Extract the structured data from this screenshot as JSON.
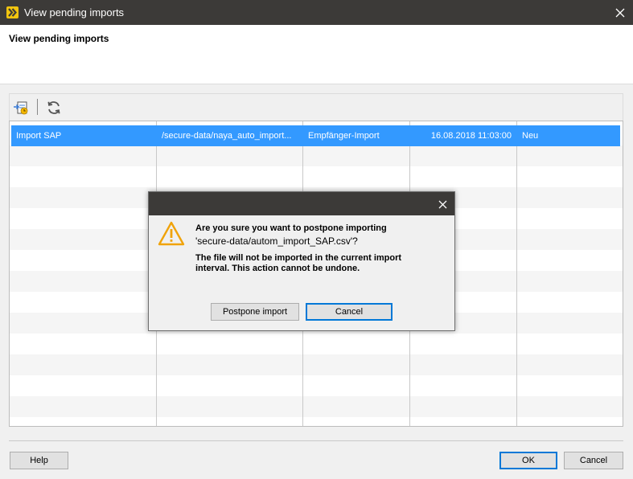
{
  "window": {
    "title": "View pending imports",
    "icon": "app-logo-icon",
    "close_icon": "close-icon"
  },
  "header": {
    "heading": "View pending imports"
  },
  "toolbar": {
    "items": [
      {
        "icon": "import-file-icon"
      },
      {
        "icon": "refresh-icon"
      }
    ]
  },
  "table": {
    "rows": [
      {
        "name": "Import SAP",
        "path": "/secure-data/naya_auto_import...",
        "type": "Empfänger-Import",
        "date": "16.08.2018 11:03:00",
        "status": "Neu"
      }
    ]
  },
  "footer": {
    "help": "Help",
    "ok": "OK",
    "cancel": "Cancel"
  },
  "dialog": {
    "icon": "warning-icon",
    "close_icon": "close-icon",
    "line1": "Are you sure you want to postpone importing",
    "line2": "'secure-data/autom_import_SAP.csv'?",
    "line3": "The file will not be imported in the current import interval. This action cannot be undone.",
    "postpone": "Postpone import",
    "cancel": "Cancel"
  },
  "colors": {
    "titlebar": "#3c3a38",
    "selection": "#3399ff",
    "warning": "#f0a30a"
  }
}
